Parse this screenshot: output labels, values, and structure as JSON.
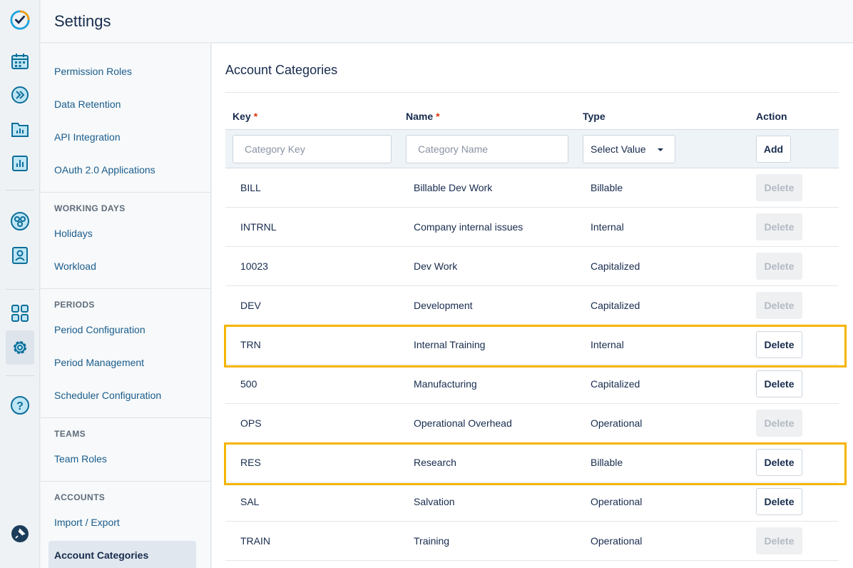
{
  "header": {
    "title": "Settings"
  },
  "rail": {
    "icons": [
      "logo-check-icon",
      "calendar-icon",
      "fast-forward-icon",
      "folder-chart-icon",
      "bar-chart-icon",
      "team-icon",
      "user-card-icon",
      "dashboard-grid-icon",
      "gear-icon",
      "help-icon",
      "pin-icon"
    ]
  },
  "nav": {
    "items": [
      {
        "label": "Permission Roles"
      },
      {
        "label": "Data Retention"
      },
      {
        "label": "API Integration"
      },
      {
        "label": "OAuth 2.0 Applications"
      }
    ],
    "working_days": {
      "title": "WORKING DAYS",
      "items": [
        "Holidays",
        "Workload"
      ]
    },
    "periods": {
      "title": "PERIODS",
      "items": [
        "Period Configuration",
        "Period Management",
        "Scheduler Configuration"
      ]
    },
    "teams": {
      "title": "TEAMS",
      "items": [
        "Team Roles"
      ]
    },
    "accounts": {
      "title": "ACCOUNTS",
      "items": [
        "Import / Export",
        "Account Categories"
      ]
    }
  },
  "main": {
    "title": "Account Categories",
    "columns": {
      "key": "Key",
      "name": "Name",
      "type": "Type",
      "action": "Action",
      "required_mark": "*"
    },
    "add_row": {
      "key_placeholder": "Category Key",
      "name_placeholder": "Category Name",
      "type_value": "Select Value",
      "add_label": "Add"
    },
    "rows": [
      {
        "key": "BILL",
        "name": "Billable Dev Work",
        "type": "Billable",
        "action": "Delete",
        "enabled": false
      },
      {
        "key": "INTRNL",
        "name": "Company internal issues",
        "type": "Internal",
        "action": "Delete",
        "enabled": false
      },
      {
        "key": "10023",
        "name": "Dev Work",
        "type": "Capitalized",
        "action": "Delete",
        "enabled": false
      },
      {
        "key": "DEV",
        "name": "Development",
        "type": "Capitalized",
        "action": "Delete",
        "enabled": false
      },
      {
        "key": "TRN",
        "name": "Internal Training",
        "type": "Internal",
        "action": "Delete",
        "enabled": true,
        "highlighted": true
      },
      {
        "key": "500",
        "name": "Manufacturing",
        "type": "Capitalized",
        "action": "Delete",
        "enabled": true
      },
      {
        "key": "OPS",
        "name": "Operational Overhead",
        "type": "Operational",
        "action": "Delete",
        "enabled": false
      },
      {
        "key": "RES",
        "name": "Research",
        "type": "Billable",
        "action": "Delete",
        "enabled": true,
        "highlighted": true
      },
      {
        "key": "SAL",
        "name": "Salvation",
        "type": "Operational",
        "action": "Delete",
        "enabled": true
      },
      {
        "key": "TRAIN",
        "name": "Training",
        "type": "Operational",
        "action": "Delete",
        "enabled": false
      }
    ]
  },
  "colors": {
    "accent": "#1a5c8c",
    "highlight": "#f5b400",
    "required": "#de350b",
    "icon": "#0d7fb0"
  }
}
